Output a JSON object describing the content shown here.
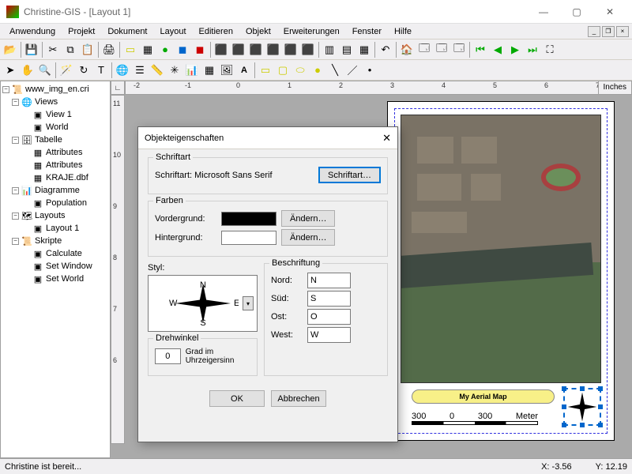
{
  "window": {
    "title": "Christine-GIS - [Layout 1]"
  },
  "menu": {
    "items": [
      "Anwendung",
      "Projekt",
      "Dokument",
      "Layout",
      "Editieren",
      "Objekt",
      "Erweiterungen",
      "Fenster",
      "Hilfe"
    ]
  },
  "ruler": {
    "units": "Inches",
    "hticks": [
      "-2",
      "-1",
      "0",
      "1",
      "2",
      "3",
      "4",
      "5",
      "6",
      "7"
    ],
    "vticks": [
      "11",
      "10",
      "9",
      "8",
      "7",
      "6"
    ]
  },
  "tree": {
    "root": "www_img_en.cri",
    "views": {
      "label": "Views",
      "items": [
        "View 1",
        "World"
      ]
    },
    "tabelle": {
      "label": "Tabelle",
      "items": [
        "Attributes",
        "Attributes",
        "KRAJE.dbf"
      ]
    },
    "diagramme": {
      "label": "Diagramme",
      "items": [
        "Population"
      ]
    },
    "layouts": {
      "label": "Layouts",
      "items": [
        "Layout 1"
      ]
    },
    "skripte": {
      "label": "Skripte",
      "items": [
        "Calculate",
        "Set Window",
        "Set World"
      ]
    }
  },
  "mapTitle": "My Aerial Map",
  "scale": {
    "ticks": [
      "300",
      "0",
      "300"
    ],
    "unit": "Meter"
  },
  "status": {
    "msg": "Christine ist bereit...",
    "x": "X: -3.56",
    "y": "Y: 12.19"
  },
  "dialog": {
    "title": "Objekteigenschaften",
    "schriftart_group": "Schriftart",
    "schriftart_label": "Schriftart: Microsoft Sans Serif",
    "schriftart_btn": "Schriftart…",
    "farben_group": "Farben",
    "vordergrund": "Vordergrund:",
    "hintergrund": "Hintergrund:",
    "aendern": "Ändern…",
    "styl": "Styl:",
    "drehwinkel": "Drehwinkel",
    "drehwinkel_val": "0",
    "drehwinkel_txt": "Grad im Uhrzeigersinn",
    "beschriftung": "Beschriftung",
    "nord": "Nord:",
    "nord_v": "N",
    "sued": "Süd:",
    "sued_v": "S",
    "ost": "Ost:",
    "ost_v": "O",
    "west": "West:",
    "west_v": "W",
    "ok": "OK",
    "cancel": "Abbrechen",
    "compass": {
      "n": "N",
      "s": "S",
      "e": "E",
      "w": "W"
    }
  }
}
